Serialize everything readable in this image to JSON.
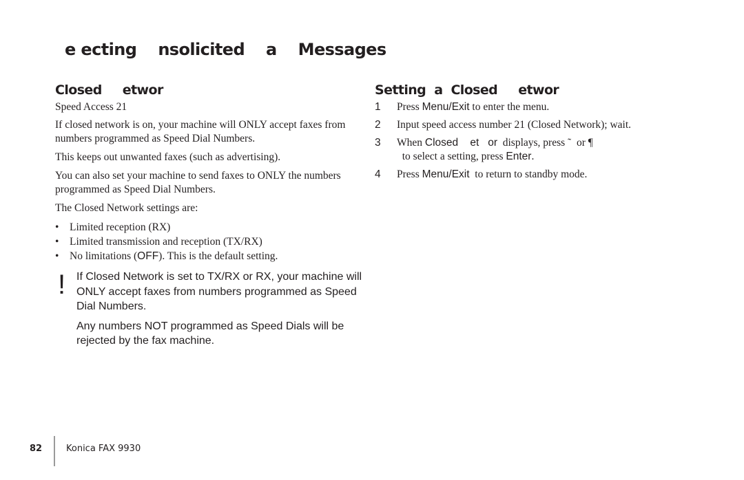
{
  "page": {
    "title": "e ecting    nsolicited    a    Messages"
  },
  "left": {
    "heading": "Closed     etwor",
    "subtitle": "Speed Access 21",
    "paragraphs": [
      "If closed network is on, your machine will ONLY accept faxes from numbers programmed as Speed Dial Numbers.",
      "This keeps out unwanted faxes (such as advertising).",
      "You can also set your machine to send faxes to ONLY the numbers programmed as Speed Dial Numbers.",
      "The Closed Network settings are:"
    ],
    "bullet_glyph": "•",
    "bullets": [
      {
        "text": "Limited reception (RX)"
      },
      {
        "text": "Limited transmission and reception (TX/RX)"
      },
      {
        "pre": "No limitations (",
        "key": "OFF",
        "post": ").  This is the default setting."
      }
    ]
  },
  "note": {
    "icon": "exclamation-icon",
    "glyph": "!",
    "paragraphs": [
      "If Closed Network is set to TX/RX or RX, your machine will ONLY accept faxes from numbers programmed as Speed Dial Numbers.",
      "Any numbers NOT programmed as Speed Dials will be rejected by the fax machine."
    ]
  },
  "right": {
    "heading": "Setting  a  Closed     etwor",
    "steps": [
      {
        "num": "1",
        "pre": "Press ",
        "key": "Menu/Exit",
        "post": " to enter the menu."
      },
      {
        "num": "2",
        "text": "Input speed access number 21 (Closed Network); wait."
      },
      {
        "num": "3",
        "pre": "When ",
        "key": "Closed    et   or",
        "mid": "  displays, press ",
        "sym1": "˜",
        "mid2": "  or ",
        "sym2": "¶",
        "post": "  to select a setting, press ",
        "key2": "Enter",
        "end": "."
      },
      {
        "num": "4",
        "pre": "Press ",
        "key": "Menu/Exit",
        "post": "  to return to standby mode."
      }
    ]
  },
  "footer": {
    "page_number": "82",
    "product": "Konica FAX 9930",
    "divider_color": "#9a9a9a"
  }
}
